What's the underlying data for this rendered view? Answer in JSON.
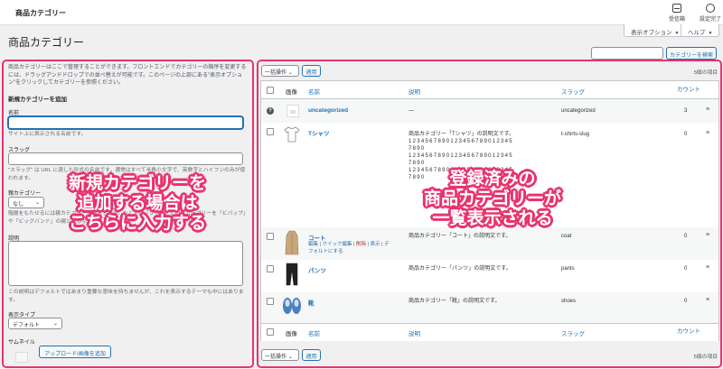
{
  "topbar": {
    "title": "商品カテゴリー",
    "inbox_label": "受信箱",
    "setup_label": "設定完了"
  },
  "page_title": "商品カテゴリー",
  "screen_options_label": "表示オプション",
  "help_label": "ヘルプ",
  "search": {
    "value": "",
    "button": "カテゴリーを検索"
  },
  "left": {
    "intro": "商品カテゴリーはここで管理することができます。フロントエンドでカテゴリーの順序を変更するには、ドラッグアンドドロップでの並べ替えが可能です。このページの上部にある\"表示オプション\"をクリックしてカテゴリーを参照ください。",
    "section_title": "新規カテゴリーを追加",
    "name_label": "名前",
    "name_value": "",
    "name_hint": "サイト上に表示される名前です。",
    "slug_label": "スラッグ",
    "slug_value": "",
    "slug_hint": "\"スラッグ\" は URL に適した形式の名前です。通常はすべて半角小文字で、英数字とハイフンのみが使われます。",
    "parent_label": "親カテゴリー",
    "parent_value": "なし",
    "parent_hint": "階層をもたせるには親カテゴリーを指定します。たとえば「ジャズ」というカテゴリーを「ビバップ」や「ビッグバンド」の親とするなどです。",
    "desc_label": "説明",
    "desc_value": "",
    "desc_hint": "この説明はデフォルトではあまり重要な意味を持ちませんが、これを表示するテーマも中にはあります。",
    "display_type_label": "表示タイプ",
    "display_type_value": "デフォルト",
    "thumbnail_label": "サムネイル",
    "upload_button": "アップロード/画像を追加"
  },
  "list": {
    "bulk_label": "一括操作",
    "apply_label": "適用",
    "items_count": "5個の項目",
    "columns": {
      "image": "画像",
      "name": "名前",
      "description": "説明",
      "slug": "スラッグ",
      "count": "カウント"
    },
    "rows": [
      {
        "name": "uncategorized",
        "description": "—",
        "slug": "uncategorized",
        "count": "3",
        "image": "placeholder"
      },
      {
        "name": "Tシャツ",
        "description": "商品カテゴリー「Tシャツ」の説明文です。",
        "desc_digits": [
          "1234567890123456789012345",
          "7890",
          "1234567890123456789012345",
          "7890",
          "1234567890123456789012345",
          "7890"
        ],
        "slug": "t-shirts-slug",
        "count": "0",
        "image": "tshirt"
      },
      {
        "name": "コート",
        "description": "商品カテゴリー「コート」の説明文です。",
        "slug": "coat",
        "count": "0",
        "image": "coat",
        "actions": {
          "edit": "編集",
          "quick_edit": "クイック編集",
          "delete": "削除",
          "view": "表示",
          "default": "デフォルトにする"
        }
      },
      {
        "name": "パンツ",
        "description": "商品カテゴリー「パンツ」の説明文です。",
        "slug": "pants",
        "count": "0",
        "image": "pants"
      },
      {
        "name": "靴",
        "description": "商品カテゴリー「靴」の説明文です。",
        "slug": "shoes",
        "count": "0",
        "image": "shoes"
      }
    ]
  },
  "annotations": {
    "left_callout": [
      "新規カテゴリーを",
      "追加する場合は",
      "こちらに入力する"
    ],
    "right_callout": [
      "登録済みの",
      "商品カテゴリーが",
      "一覧表示される"
    ],
    "accent_color": "#e8336d"
  },
  "colors": {
    "link": "#2271b1",
    "background": "#f0f0f1",
    "delete": "#b32d2e"
  }
}
